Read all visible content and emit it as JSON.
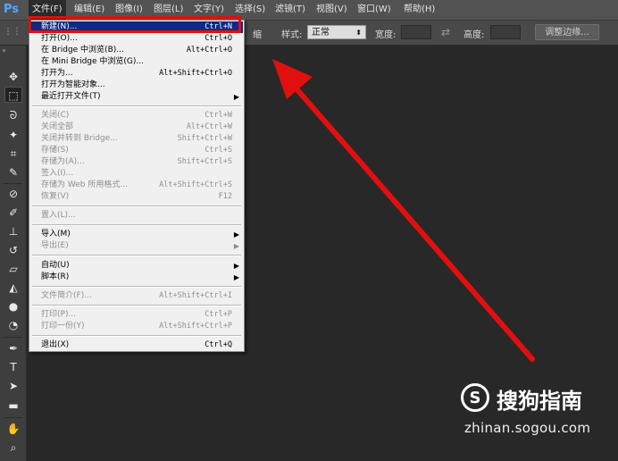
{
  "app": {
    "logo": "Ps"
  },
  "menubar": [
    "文件(F)",
    "编辑(E)",
    "图像(I)",
    "图层(L)",
    "文字(Y)",
    "选择(S)",
    "滤镜(T)",
    "视图(V)",
    "窗口(W)",
    "帮助(H)"
  ],
  "options": {
    "partial_label": "缩",
    "style_label": "样式:",
    "style_value": "正常",
    "width_label": "宽度:",
    "height_label": "高度:",
    "refine_button": "调整边缘..."
  },
  "file_menu": [
    {
      "label": "新建(N)...",
      "shortcut": "Ctrl+N",
      "highlighted": true
    },
    {
      "label": "打开(O)...",
      "shortcut": "Ctrl+O"
    },
    {
      "label": "在 Bridge 中浏览(B)...",
      "shortcut": "Alt+Ctrl+O"
    },
    {
      "label": "在 Mini Bridge 中浏览(G)...",
      "shortcut": ""
    },
    {
      "label": "打开为...",
      "shortcut": "Alt+Shift+Ctrl+O"
    },
    {
      "label": "打开为智能对象...",
      "shortcut": ""
    },
    {
      "label": "最近打开文件(T)",
      "shortcut": "",
      "submenu": true
    },
    {
      "label": "关闭(C)",
      "shortcut": "Ctrl+W",
      "disabled": true
    },
    {
      "label": "关闭全部",
      "shortcut": "Alt+Ctrl+W",
      "disabled": true
    },
    {
      "label": "关闭并转到 Bridge...",
      "shortcut": "Shift+Ctrl+W",
      "disabled": true
    },
    {
      "label": "存储(S)",
      "shortcut": "Ctrl+S",
      "disabled": true
    },
    {
      "label": "存储为(A)...",
      "shortcut": "Shift+Ctrl+S",
      "disabled": true
    },
    {
      "label": "签入(I)...",
      "shortcut": "",
      "disabled": true
    },
    {
      "label": "存储为 Web 所用格式...",
      "shortcut": "Alt+Shift+Ctrl+S",
      "disabled": true
    },
    {
      "label": "恢复(V)",
      "shortcut": "F12",
      "disabled": true
    },
    {
      "label": "置入(L)...",
      "shortcut": "",
      "disabled": true
    },
    {
      "label": "导入(M)",
      "shortcut": "",
      "submenu": true
    },
    {
      "label": "导出(E)",
      "shortcut": "",
      "submenu": true,
      "disabled": true
    },
    {
      "label": "自动(U)",
      "shortcut": "",
      "submenu": true
    },
    {
      "label": "脚本(R)",
      "shortcut": "",
      "submenu": true
    },
    {
      "label": "文件简介(F)...",
      "shortcut": "Alt+Shift+Ctrl+I",
      "disabled": true
    },
    {
      "label": "打印(P)...",
      "shortcut": "Ctrl+P",
      "disabled": true
    },
    {
      "label": "打印一份(Y)",
      "shortcut": "Alt+Shift+Ctrl+P",
      "disabled": true
    },
    {
      "label": "退出(X)",
      "shortcut": "Ctrl+Q"
    }
  ],
  "tools": [
    "move-tool-icon",
    "marquee-tool-icon",
    "lasso-tool-icon",
    "magic-wand-tool-icon",
    "crop-tool-icon",
    "eyedropper-tool-icon",
    "healing-brush-tool-icon",
    "brush-tool-icon",
    "clone-stamp-tool-icon",
    "history-brush-tool-icon",
    "eraser-tool-icon",
    "paint-bucket-tool-icon",
    "blur-tool-icon",
    "dodge-tool-icon",
    "pen-tool-icon",
    "type-tool-icon",
    "path-selection-tool-icon",
    "rectangle-tool-icon",
    "hand-tool-icon",
    "zoom-tool-icon"
  ],
  "watermark": {
    "title": "搜狗指南",
    "url": "zhinan.sogou.com",
    "logo": "S"
  },
  "colors": {
    "highlight_box": "#e10f0f",
    "arrow": "#e10f0f",
    "menu_highlight": "#0b2a8a"
  }
}
